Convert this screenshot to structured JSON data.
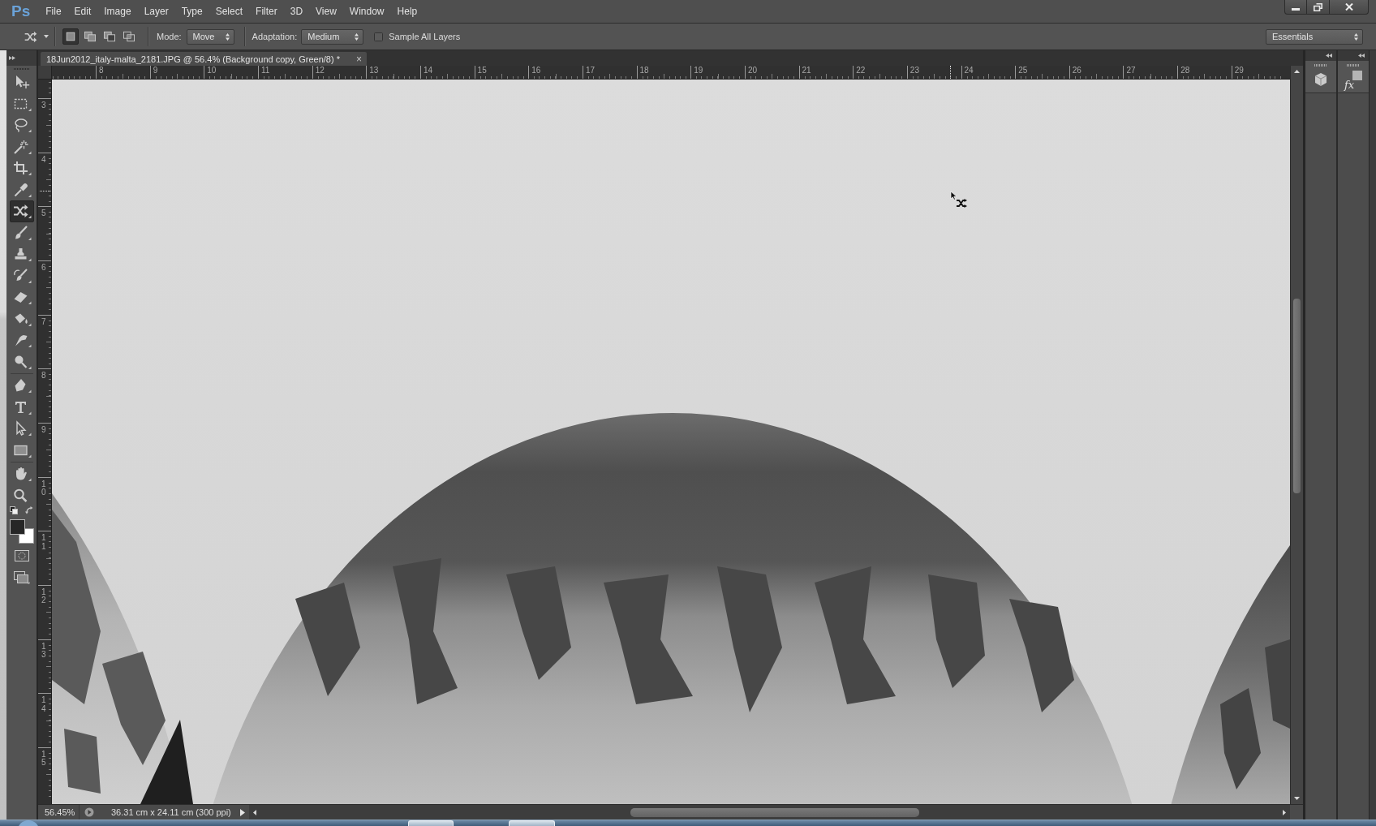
{
  "menu_bar": {
    "logo": "Ps",
    "items": [
      "File",
      "Edit",
      "Image",
      "Layer",
      "Type",
      "Select",
      "Filter",
      "3D",
      "View",
      "Window",
      "Help"
    ]
  },
  "options_bar": {
    "selection_modes": [
      {
        "kind": "new",
        "selected": true
      },
      {
        "kind": "add",
        "selected": false
      },
      {
        "kind": "subtract",
        "selected": false
      },
      {
        "kind": "intersect",
        "selected": false
      }
    ],
    "mode": {
      "label": "Mode:",
      "value": "Move"
    },
    "adaptation": {
      "label": "Adaptation:",
      "value": "Medium"
    },
    "sample_all_layers": {
      "label": "Sample All Layers",
      "checked": false
    },
    "workspace": "Essentials"
  },
  "toolbar": {
    "groups": [
      [
        {
          "kind": "move",
          "selected": false
        },
        {
          "kind": "marquee",
          "selected": false
        },
        {
          "kind": "lasso",
          "selected": false
        },
        {
          "kind": "wand",
          "selected": false
        },
        {
          "kind": "crop",
          "selected": false
        },
        {
          "kind": "eyedropper",
          "selected": false
        },
        {
          "kind": "patch",
          "selected": true
        },
        {
          "kind": "brush",
          "selected": false
        },
        {
          "kind": "stamp",
          "selected": false
        },
        {
          "kind": "history",
          "selected": false
        },
        {
          "kind": "eraser",
          "selected": false
        },
        {
          "kind": "bucket",
          "selected": false
        },
        {
          "kind": "smudge",
          "selected": false
        },
        {
          "kind": "dodge",
          "selected": false
        }
      ],
      [
        {
          "kind": "pen",
          "selected": false
        },
        {
          "kind": "type",
          "selected": false
        },
        {
          "kind": "path",
          "selected": false
        },
        {
          "kind": "shape",
          "selected": false
        }
      ],
      [
        {
          "kind": "hand",
          "selected": false
        },
        {
          "kind": "zoom",
          "selected": false
        }
      ]
    ]
  },
  "document_tab": {
    "title": "18Jun2012_italy-malta_2181.JPG @ 56.4% (Background copy, Green/8) *",
    "close": "×"
  },
  "rulers": {
    "horizontal": [
      "8",
      "9",
      "10",
      "11",
      "12",
      "13",
      "14",
      "15",
      "16",
      "17",
      "18",
      "19",
      "20",
      "21",
      "22",
      "23",
      "24",
      "25",
      "26",
      "27",
      "28",
      "29"
    ],
    "vertical": [
      "3",
      "4",
      "5",
      "6",
      "7",
      "8",
      "9",
      "10",
      "11",
      "12",
      "13",
      "14",
      "15"
    ]
  },
  "dock": {
    "buttons": [
      {
        "kind": "cube"
      },
      {
        "kind": "styles",
        "label": "fx"
      }
    ]
  },
  "status_bar": {
    "zoom": "56.45%",
    "document_size": "36.31 cm x 24.11 cm (300 ppi)"
  }
}
